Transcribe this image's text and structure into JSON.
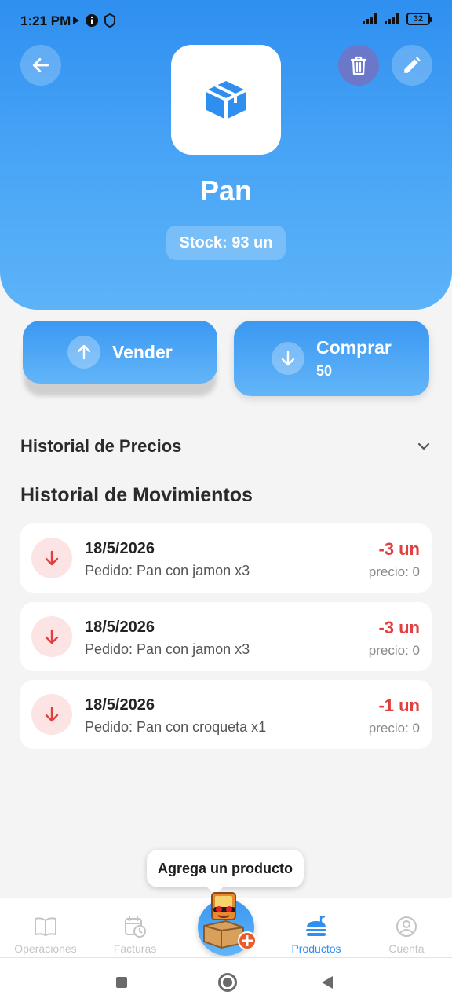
{
  "status_bar": {
    "time": "1:21 PM",
    "battery": "32"
  },
  "product": {
    "name": "Pan",
    "stock": "Stock: 93 un"
  },
  "actions": {
    "sell": {
      "label": "Vender"
    },
    "buy": {
      "label": "Comprar",
      "sub": "50"
    }
  },
  "sections": {
    "price_history": "Historial de Precios",
    "movements": "Historial de Movimientos"
  },
  "movements": [
    {
      "date": "18/5/2026",
      "desc": "Pedido: Pan con jamon x3",
      "qty": "-3 un",
      "price": "precio: 0"
    },
    {
      "date": "18/5/2026",
      "desc": "Pedido: Pan con jamon x3",
      "qty": "-3 un",
      "price": "precio: 0"
    },
    {
      "date": "18/5/2026",
      "desc": "Pedido: Pan con croqueta x1",
      "qty": "-1 un",
      "price": "precio: 0"
    }
  ],
  "tooltip": "Agrega un producto",
  "nav": {
    "operaciones": "Operaciones",
    "facturas": "Facturas",
    "productos": "Productos",
    "cuenta": "Cuenta"
  },
  "colors": {
    "primary": "#2f8ff0",
    "danger": "#e04040",
    "trash_bg": "#6b78c9"
  }
}
